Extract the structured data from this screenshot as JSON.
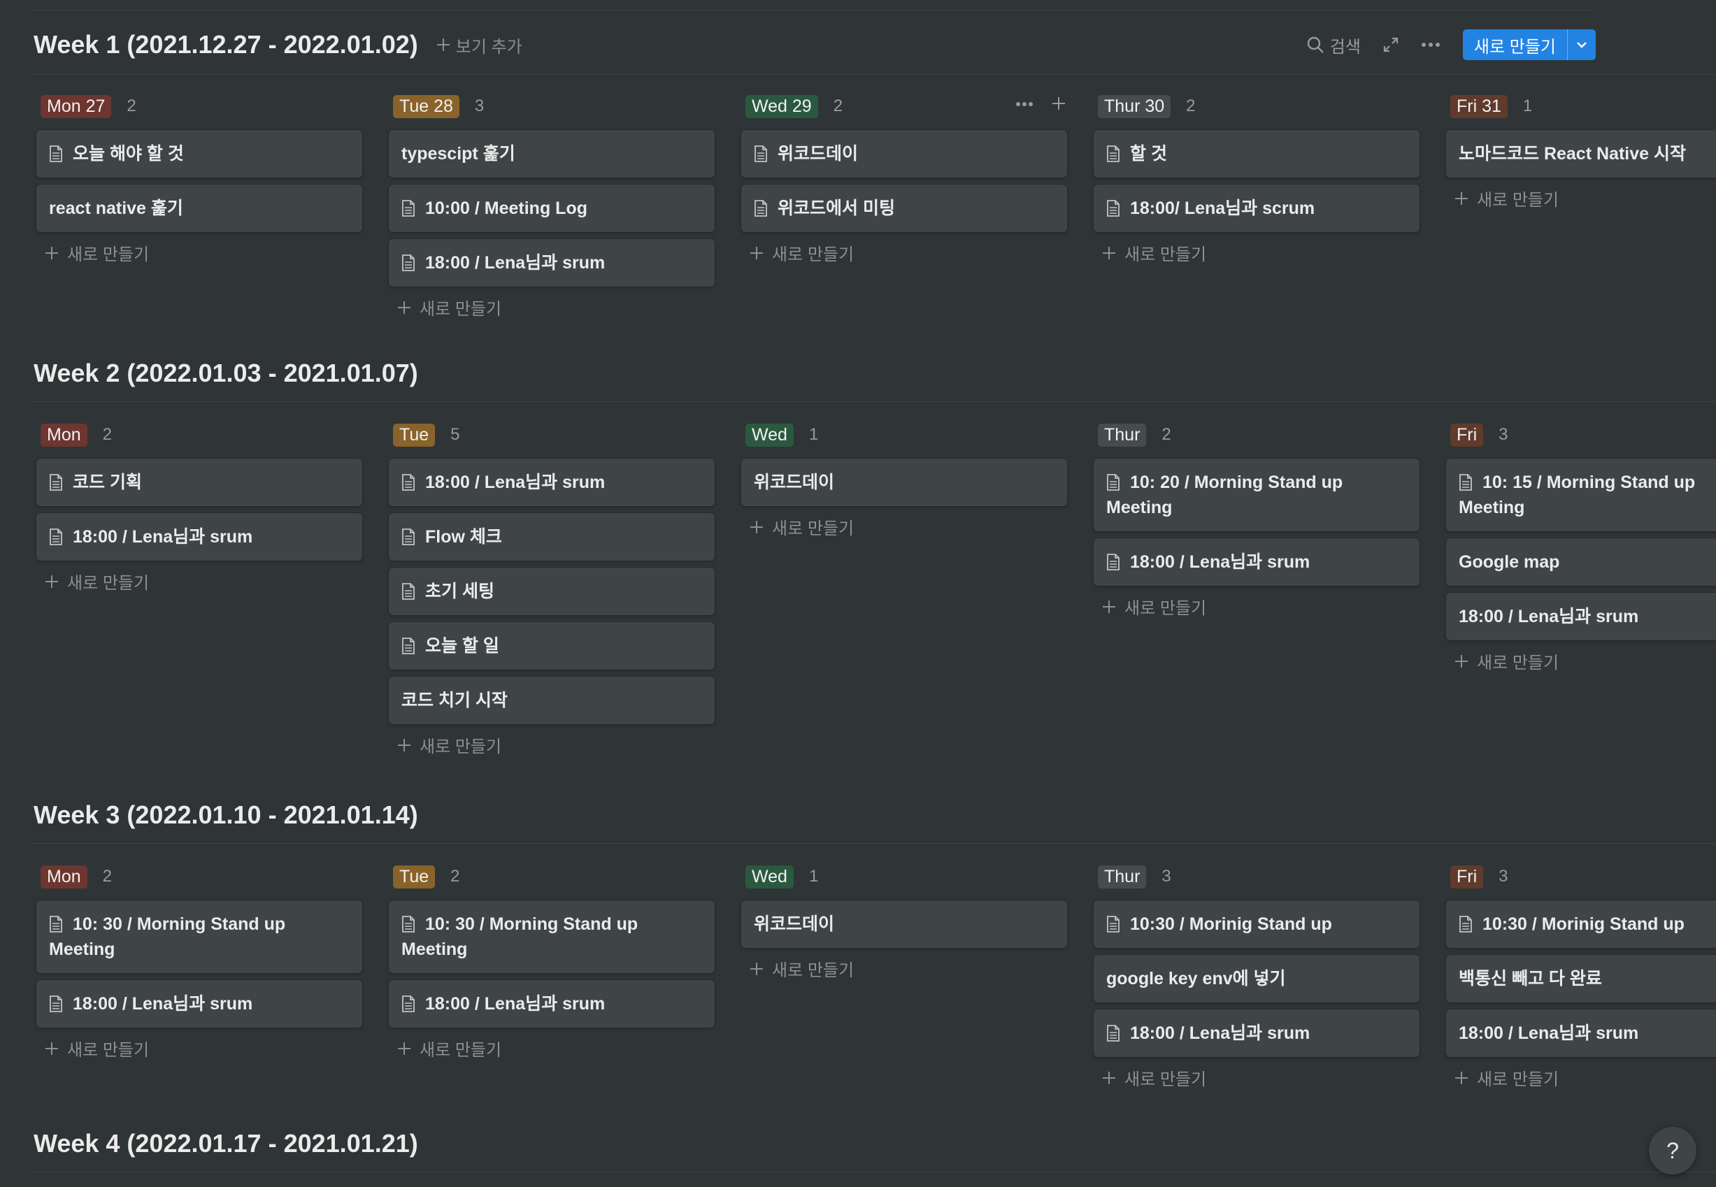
{
  "toolbar": {
    "search_label": "검색",
    "new_button_label": "새로 만들기"
  },
  "add_view_label": "보기 추가",
  "new_item_label": "새로 만들기",
  "tag_colors": {
    "red": "#6e3630",
    "yellow": "#89632a",
    "green": "#2b593f",
    "gray": "#454b4e",
    "brown": "#603b2c"
  },
  "weeks": [
    {
      "title": "Week 1 (2021.12.27 - 2022.01.02)",
      "columns": [
        {
          "label": "Mon 27",
          "count": "2",
          "color": "red",
          "cards": [
            {
              "text": "오늘 해야 할 것",
              "icon": "page-icon"
            },
            {
              "text": "react native 훑기",
              "icon": null
            }
          ]
        },
        {
          "label": "Tue 28",
          "count": "3",
          "color": "yellow",
          "cards": [
            {
              "text": "typescipt 훑기",
              "icon": null
            },
            {
              "text": "10:00 / Meeting Log",
              "icon": "page-icon"
            },
            {
              "text": "18:00 / Lena님과 srum",
              "icon": "page-icon"
            }
          ]
        },
        {
          "label": "Wed 29",
          "count": "2",
          "color": "green",
          "cards": [
            {
              "text": "위코드데이",
              "icon": "page-icon"
            },
            {
              "text": "위코드에서 미팅",
              "icon": "page-icon"
            }
          ]
        },
        {
          "label": "Thur 30",
          "count": "2",
          "color": "gray",
          "cards": [
            {
              "text": "할 것",
              "icon": "page-icon"
            },
            {
              "text": "18:00/ Lena님과 scrum",
              "icon": "page-icon"
            }
          ]
        },
        {
          "label": "Fri 31",
          "count": "1",
          "color": "brown",
          "cards": [
            {
              "text": "노마드코드 React Native 시작",
              "icon": null
            }
          ]
        }
      ]
    },
    {
      "title": "Week 2 (2022.01.03 - 2021.01.07)",
      "columns": [
        {
          "label": "Mon",
          "count": "2",
          "color": "red",
          "cards": [
            {
              "text": "코드 기획",
              "icon": "page-icon"
            },
            {
              "text": "18:00 / Lena님과 srum",
              "icon": "page-icon"
            }
          ]
        },
        {
          "label": "Tue",
          "count": "5",
          "color": "yellow",
          "cards": [
            {
              "text": "18:00 / Lena님과 srum",
              "icon": "page-icon"
            },
            {
              "text": "Flow 체크",
              "icon": "page-icon"
            },
            {
              "text": "초기 세팅",
              "icon": "page-icon"
            },
            {
              "text": "오늘 할 일",
              "icon": "page-icon"
            },
            {
              "text": "코드 치기 시작",
              "icon": null
            }
          ]
        },
        {
          "label": "Wed",
          "count": "1",
          "color": "green",
          "cards": [
            {
              "text": "위코드데이",
              "icon": null
            }
          ]
        },
        {
          "label": "Thur",
          "count": "2",
          "color": "gray",
          "cards": [
            {
              "text": "10: 20 / Morning Stand up Meeting",
              "icon": "page-icon"
            },
            {
              "text": "18:00 / Lena님과 srum",
              "icon": "page-icon"
            }
          ]
        },
        {
          "label": "Fri",
          "count": "3",
          "color": "brown",
          "cards": [
            {
              "text": "10: 15 / Morning Stand up Meeting",
              "icon": "page-icon"
            },
            {
              "text": "Google map",
              "icon": null
            },
            {
              "text": "18:00 / Lena님과 srum",
              "icon": null
            }
          ]
        }
      ]
    },
    {
      "title": "Week 3 (2022.01.10 - 2021.01.14)",
      "columns": [
        {
          "label": "Mon",
          "count": "2",
          "color": "red",
          "cards": [
            {
              "text": "10: 30 / Morning Stand up Meeting",
              "icon": "page-icon"
            },
            {
              "text": "18:00 / Lena님과 srum",
              "icon": "page-icon"
            }
          ]
        },
        {
          "label": "Tue",
          "count": "2",
          "color": "yellow",
          "cards": [
            {
              "text": "10: 30 / Morning Stand up Meeting",
              "icon": "page-icon"
            },
            {
              "text": "18:00 / Lena님과 srum",
              "icon": "page-icon"
            }
          ]
        },
        {
          "label": "Wed",
          "count": "1",
          "color": "green",
          "cards": [
            {
              "text": "위코드데이",
              "icon": null
            }
          ]
        },
        {
          "label": "Thur",
          "count": "3",
          "color": "gray",
          "cards": [
            {
              "text": "10:30 / Morinig Stand up",
              "icon": "page-icon"
            },
            {
              "text": "google key env에 넣기",
              "icon": null
            },
            {
              "text": "18:00 / Lena님과 srum",
              "icon": "page-icon"
            }
          ]
        },
        {
          "label": "Fri",
          "count": "3",
          "color": "brown",
          "cards": [
            {
              "text": "10:30 / Morinig Stand up",
              "icon": "page-icon"
            },
            {
              "text": "백통신 빼고 다 완료",
              "icon": null
            },
            {
              "text": "18:00 / Lena님과 srum",
              "icon": null
            }
          ]
        }
      ]
    },
    {
      "title": "Week 4 (2022.01.17 - 2021.01.21)",
      "columns": []
    }
  ],
  "help_label": "?"
}
